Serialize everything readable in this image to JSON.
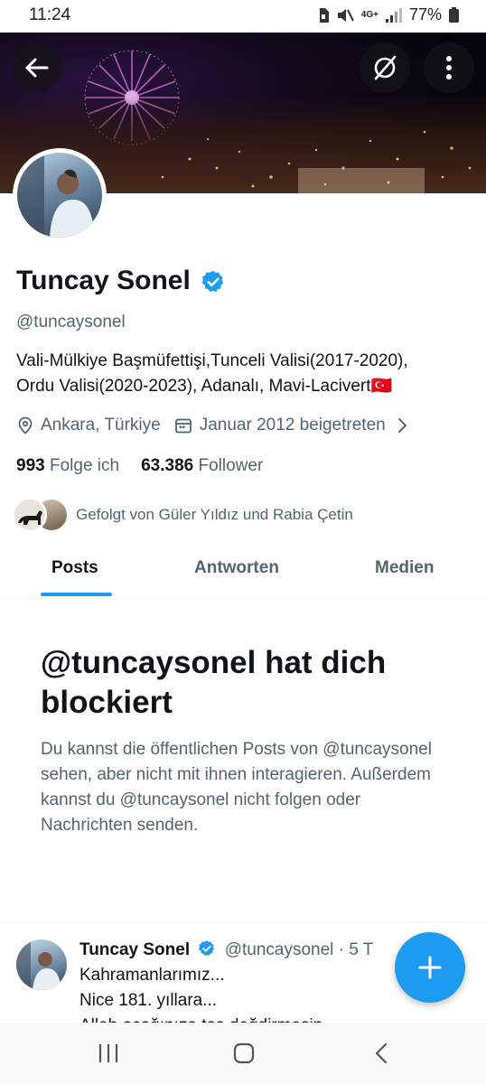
{
  "status_bar": {
    "time": "11:24",
    "network": "4G+",
    "battery": "77%"
  },
  "profile": {
    "name": "Tuncay Sonel",
    "handle": "@tuncaysonel",
    "bio_line1": "Vali-Mülkiye Başmüfettişi,Tunceli Valisi(2017-2020),",
    "bio_line2": "Ordu Valisi(2020-2023), Adanalı, Mavi-Lacivert🇹🇷",
    "location": "Ankara, Türkiye",
    "joined": "Januar 2012 beigetreten",
    "following_count": "993",
    "following_label": "Folge ich",
    "followers_count": "63.386",
    "followers_label": "Follower",
    "followed_by": "Gefolgt von Güler Yıldız und Rabia Çetin"
  },
  "tabs": [
    {
      "label": "Posts",
      "active": true
    },
    {
      "label": "Antworten",
      "active": false
    },
    {
      "label": "Medien",
      "active": false
    }
  ],
  "blocked": {
    "title": "@tuncaysonel hat dich blockiert",
    "text": "Du kannst die öffentlichen Posts von @tuncaysonel sehen, aber nicht mit ihnen interagieren. Außerdem kannst du @tuncaysonel nicht folgen oder Nachrichten senden."
  },
  "post": {
    "author": "Tuncay Sonel",
    "handle_time": "@tuncaysonel · 5 T",
    "line1": "Kahramanlarımız...",
    "line2": "Nice 181. yıllara...",
    "line3": "Allah ocağınıza taş değdirmesin..."
  },
  "colors": {
    "accent": "#1d9bf0",
    "text": "#0f1419",
    "secondary": "#536471"
  },
  "icons": {
    "back": "arrow-left-icon",
    "grok": "grok-icon",
    "more": "more-vertical-icon",
    "verified": "verified-badge-icon",
    "location": "location-pin-icon",
    "calendar": "calendar-icon",
    "compose": "plus-icon"
  }
}
